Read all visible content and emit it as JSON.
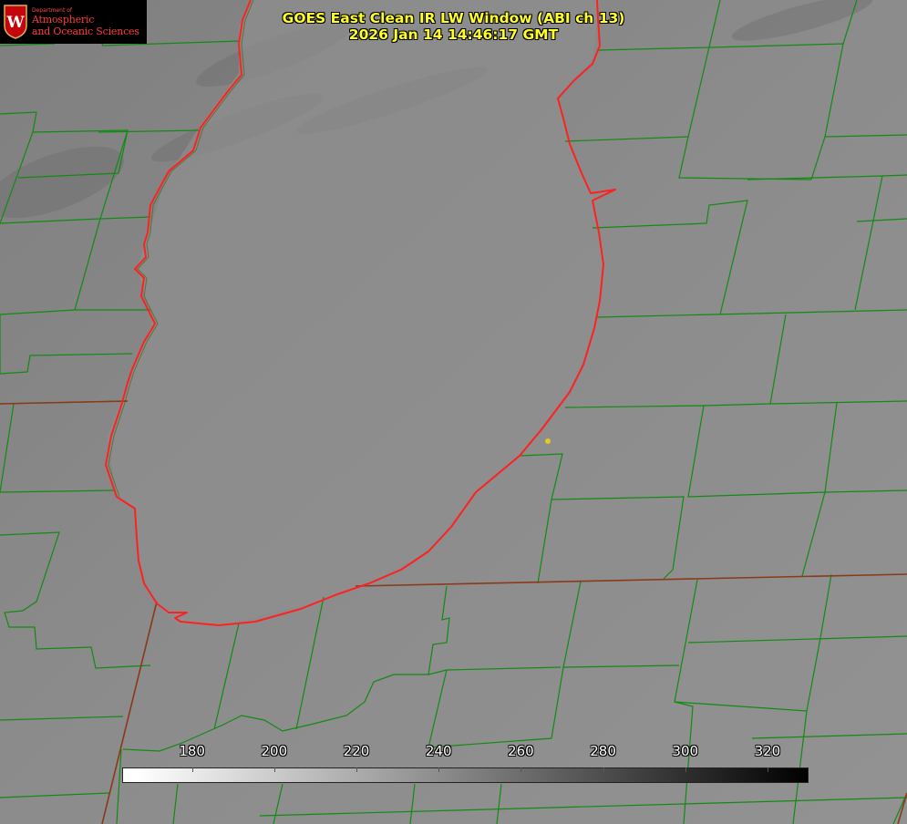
{
  "header": {
    "title_line1": "GOES East Clean IR LW Window (ABI ch 13)",
    "title_line2": "2026 Jan 14 14:46:17 GMT"
  },
  "logo": {
    "crest_letter": "W",
    "dept_text": "Department of",
    "name_line1": "Atmospheric",
    "name_line2": "and Oceanic Sciences"
  },
  "colorbar": {
    "ticks": [
      {
        "value": 180,
        "label": "180"
      },
      {
        "value": 200,
        "label": "200"
      },
      {
        "value": 220,
        "label": "220"
      },
      {
        "value": 240,
        "label": "240"
      },
      {
        "value": 260,
        "label": "260"
      },
      {
        "value": 280,
        "label": "280"
      },
      {
        "value": 300,
        "label": "300"
      },
      {
        "value": 320,
        "label": "320"
      }
    ],
    "range": [
      163,
      330
    ],
    "gradient": "white-to-black"
  },
  "colors": {
    "title": "#ffff2a",
    "coastline": "#ff2020",
    "boundaries": "#138a13",
    "marker": "#e6c81e",
    "background": "#8a8a8a"
  }
}
